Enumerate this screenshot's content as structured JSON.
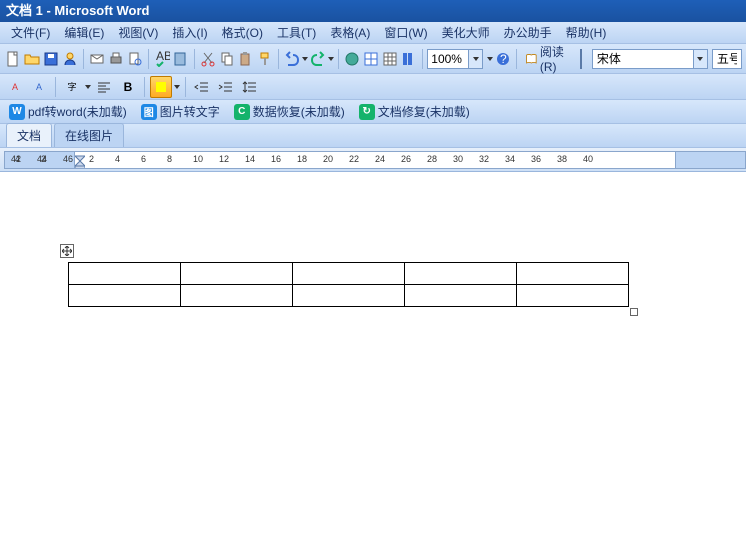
{
  "title": "文档 1 - Microsoft Word",
  "menu": [
    "文件(F)",
    "编辑(E)",
    "视图(V)",
    "插入(I)",
    "格式(O)",
    "工具(T)",
    "表格(A)",
    "窗口(W)",
    "美化大师",
    "办公助手",
    "帮助(H)"
  ],
  "zoom": "100%",
  "read_label": "阅读(R)",
  "font": "宋体",
  "font_size": "五号",
  "addons": [
    {
      "label": "pdf转word(未加载)",
      "color": "#1e88e5",
      "ico": "W"
    },
    {
      "label": "图片转文字",
      "color": "#1e88e5",
      "ico": "图"
    },
    {
      "label": "数据恢复(未加载)",
      "color": "#14b36b",
      "ico": "C"
    },
    {
      "label": "文档修复(未加载)",
      "color": "#14b36b",
      "ico": "↻"
    }
  ],
  "tabs": [
    "文档",
    "在线图片"
  ],
  "ruler_left": [
    "4",
    "2"
  ],
  "ruler_body": [
    "2",
    "4",
    "6",
    "8",
    "10",
    "12",
    "14",
    "16",
    "18",
    "20",
    "22",
    "24",
    "26",
    "28",
    "30",
    "32",
    "34",
    "36",
    "38",
    "40"
  ],
  "ruler_right": [
    "42",
    "44",
    "46"
  ],
  "table": {
    "rows": 2,
    "cols": 5
  }
}
